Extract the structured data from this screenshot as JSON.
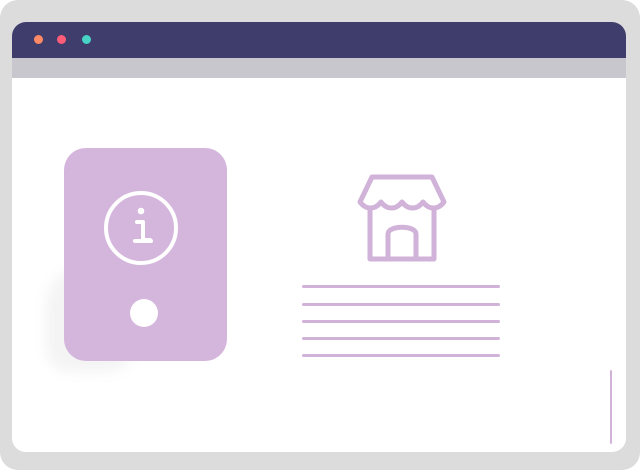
{
  "colors": {
    "titlebar": "#3f3d6b",
    "subbar": "#c8c7cd",
    "accent": "#d4b6dc",
    "line": "#d1b2d9",
    "background": "#ffffff",
    "frame": "#dcdcdc",
    "dot_orange": "#ff8a65",
    "dot_red": "#ff5c7a",
    "dot_teal": "#47d3c6"
  },
  "icons": {
    "info": "info-icon",
    "store": "store-icon",
    "phone_button": "circle-button-icon"
  },
  "window": {
    "traffic_lights": [
      "orange",
      "red",
      "teal"
    ]
  }
}
